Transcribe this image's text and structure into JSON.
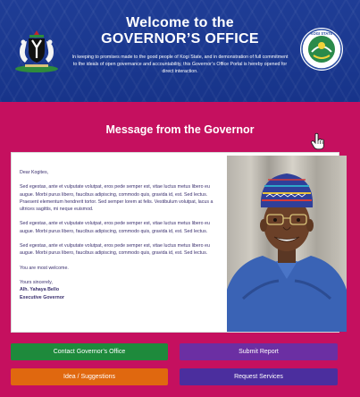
{
  "header": {
    "title_line1": "Welcome to the",
    "title_line2": "GOVERNOR’S OFFICE",
    "intro": "In keeping to promises made to the good people of Kogi State, and in demonstration of full commitment to the ideals of open governance and accountability, this Governor’s Office Portal is hereby opened for direct interaction.",
    "seal_text": "KOGI STATE"
  },
  "section": {
    "title": "Message from the Governor"
  },
  "letter": {
    "greeting": "Dear Kogites,",
    "paragraphs": [
      "Sed egestas, ante et vulputate volutpat, eros pede semper est, vitae luctus metus libero eu augue. Morbi purus libero, faucibus adipiscing, commodo quis, gravida id, est. Sed lectus. Praesent elementum hendrerit tortor. Sed semper lorem at felis. Vestibulum volutpat, lacus a ultrices sagittis, mi neque euismod.",
      "Sed egestas, ante et vulputate volutpat, eros pede semper est, vitae luctus metus libero eu augue. Morbi purus libero, faucibus adipiscing, commodo quis, gravida id, est. Sed lectus.",
      "Sed egestas, ante et vulputate volutpat, eros pede semper est, vitae luctus metus libero eu augue. Morbi purus libero, faucibus adipiscing, commodo quis, gravida id, est. Sed lectus."
    ],
    "closing_line": "You are most welcome.",
    "signoff": "Yours sincerely,",
    "signer_name": "Alh. Yahaya Bello",
    "signer_title": "Executive Governor"
  },
  "buttons": {
    "contact": "Contact Governor’s Office",
    "submit": "Submit Report",
    "idea": "Idea / Suggestions",
    "request": "Request Services"
  },
  "colors": {
    "header_bg": "#1f3d96",
    "page_bg": "#c5105f",
    "contact": "#1e8a3c",
    "submit": "#6b2fa3",
    "idea": "#e0680f",
    "request": "#4b2e9e"
  },
  "icons": {
    "coat_of_arms": "nigeria-coat-of-arms-icon",
    "seal": "kogi-state-seal-icon",
    "cursor": "hand-pointer-cursor-icon"
  }
}
